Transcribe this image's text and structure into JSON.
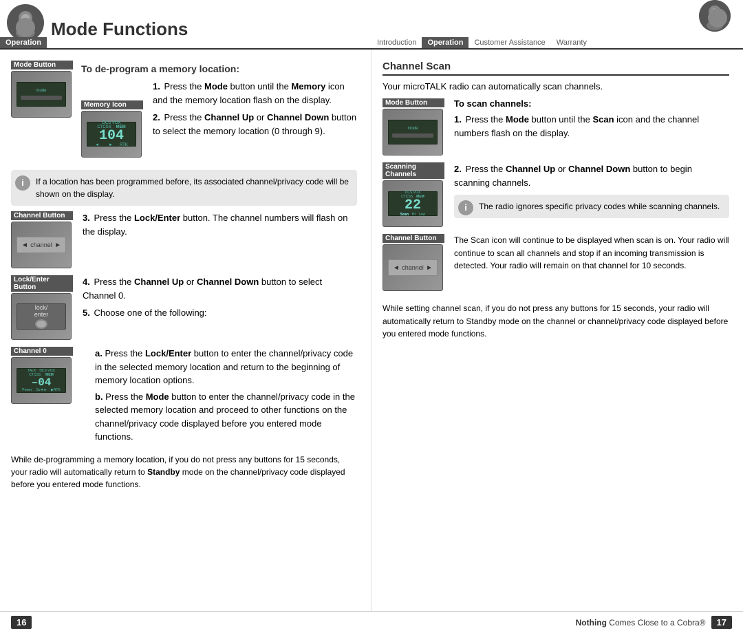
{
  "header": {
    "left": {
      "title": "Mode Functions",
      "section_label": "Operation"
    },
    "right": {
      "nav_items": [
        "Introduction",
        "Operation",
        "Customer Assistance",
        "Warranty"
      ]
    }
  },
  "left_page": {
    "page_number": "16",
    "section": {
      "heading": "To de-program a memory location:",
      "steps": [
        {
          "num": "1.",
          "text_parts": [
            "Press the ",
            "Mode",
            " button until the ",
            "Memory",
            " icon and the memory location flash on the display."
          ]
        },
        {
          "num": "2.",
          "text_parts": [
            "Press the ",
            "Channel Up",
            " or ",
            "Channel Down",
            " button to select the memory location (0 through 9)."
          ]
        },
        {
          "note": "If a location has been programmed before, its associated channel/privacy code will be shown on the displayed."
        },
        {
          "num": "3.",
          "text_parts": [
            "Press the ",
            "Lock/Enter",
            " button. The channel numbers will flash on the display."
          ]
        },
        {
          "num": "4.",
          "text_parts": [
            "Press the ",
            "Channel Up",
            " or ",
            "Channel Down",
            " button to select Channel 0."
          ]
        },
        {
          "num": "5.",
          "text": "Choose one of the following:"
        }
      ],
      "sub_steps": [
        {
          "label": "a.",
          "text_parts": [
            "Press the ",
            "Lock/Enter",
            " button to enter the channel/privacy code in the selected memory location and return to the beginning of memory location options."
          ]
        },
        {
          "label": "b.",
          "text_parts": [
            "Press the ",
            "Mode",
            " button to enter the channel/privacy code in the selected memory location and proceed to other functions on the channel/privacy code displayed before you entered mode functions."
          ]
        }
      ],
      "footer_note": "While de-programming a memory location, if you do not press any buttons for 15 seconds, your radio will automatically return to Standby mode on the channel/privacy code displayed before you entered mode functions."
    },
    "sidebar_items": [
      {
        "label": "Mode Button",
        "type": "radio_mode"
      },
      {
        "label": "Memory Icon",
        "type": "radio_memory"
      },
      {
        "label": "Channel Button",
        "type": "radio_channel"
      },
      {
        "label": "Lock/Enter Button",
        "type": "radio_lock"
      },
      {
        "label": "Channel 0",
        "type": "radio_ch0"
      }
    ]
  },
  "right_page": {
    "page_number": "17",
    "channel_scan": {
      "heading": "Channel Scan",
      "intro": "Your microTALK radio can automatically scan channels.",
      "scan_steps_heading": "To scan channels:",
      "steps": [
        {
          "num": "1.",
          "text_parts": [
            "Press the ",
            "Mode",
            " button until the ",
            "Scan",
            " icon and the channel numbers flash on the display."
          ]
        },
        {
          "num": "2.",
          "text_parts": [
            "Press the ",
            "Channel Up",
            " or ",
            "Channel Down",
            " button to begin scanning channels."
          ]
        },
        {
          "note": "The radio ignores specific privacy codes while scanning channels."
        }
      ],
      "scan_body": "The Scan icon will continue to be displayed when scan is on. Your radio will continue to scan all channels and stop if an incoming transmission is detected. Your radio will remain on that channel for 10 seconds.",
      "standby_note": "While setting channel scan, if you do not press any buttons for 15 seconds, your radio will automatically return to Standby mode on the channel or channel/privacy code displayed before you entered mode functions."
    },
    "sidebar_items": [
      {
        "label": "Mode Button",
        "type": "radio_mode_right"
      },
      {
        "label": "Scanning Channels",
        "type": "radio_scanning"
      },
      {
        "label": "Channel Button",
        "type": "radio_channel_right"
      }
    ]
  },
  "footer": {
    "tagline_bold": "Nothing",
    "tagline_rest": " Comes Close to a Cobra®"
  }
}
